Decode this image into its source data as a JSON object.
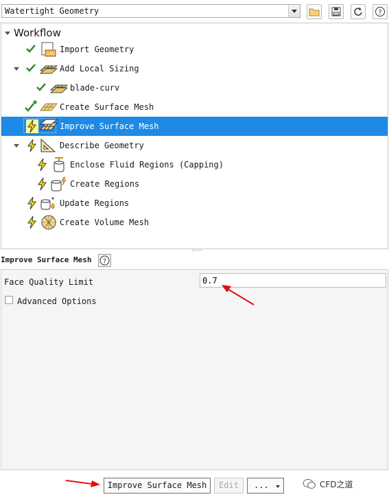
{
  "workflow_selector": {
    "value": "Watertight Geometry"
  },
  "toolbar": {
    "icons": [
      "folder-icon",
      "save-icon",
      "refresh-icon",
      "help-icon"
    ]
  },
  "tree": {
    "title": "Workflow",
    "items": [
      {
        "label": "Import Geometry",
        "status": "done"
      },
      {
        "label": "Add Local Sizing",
        "status": "done"
      },
      {
        "label": "blade-curv",
        "status": "done"
      },
      {
        "label": "Create Surface Mesh",
        "status": "done-new"
      },
      {
        "label": "Improve Surface Mesh",
        "status": "pending",
        "selected": true
      },
      {
        "label": "Describe Geometry",
        "status": "pending"
      },
      {
        "label": "Enclose Fluid Regions (Capping)",
        "status": "pending"
      },
      {
        "label": "Create Regions",
        "status": "pending"
      },
      {
        "label": "Update Regions",
        "status": "pending"
      },
      {
        "label": "Create Volume Mesh",
        "status": "pending"
      }
    ]
  },
  "properties": {
    "title": "Improve Surface Mesh",
    "face_quality_label": "Face Quality Limit",
    "face_quality_value": "0.7",
    "advanced_label": "Advanced Options",
    "advanced_checked": false
  },
  "buttons": {
    "run": "Improve Surface Mesh",
    "edit": "Edit",
    "more": "..."
  },
  "watermark": "CFD之道",
  "colors": {
    "selection": "#1e8ae6",
    "check": "#2e8b2e",
    "lightning": "#f5e000",
    "arrow": "#e01010"
  }
}
